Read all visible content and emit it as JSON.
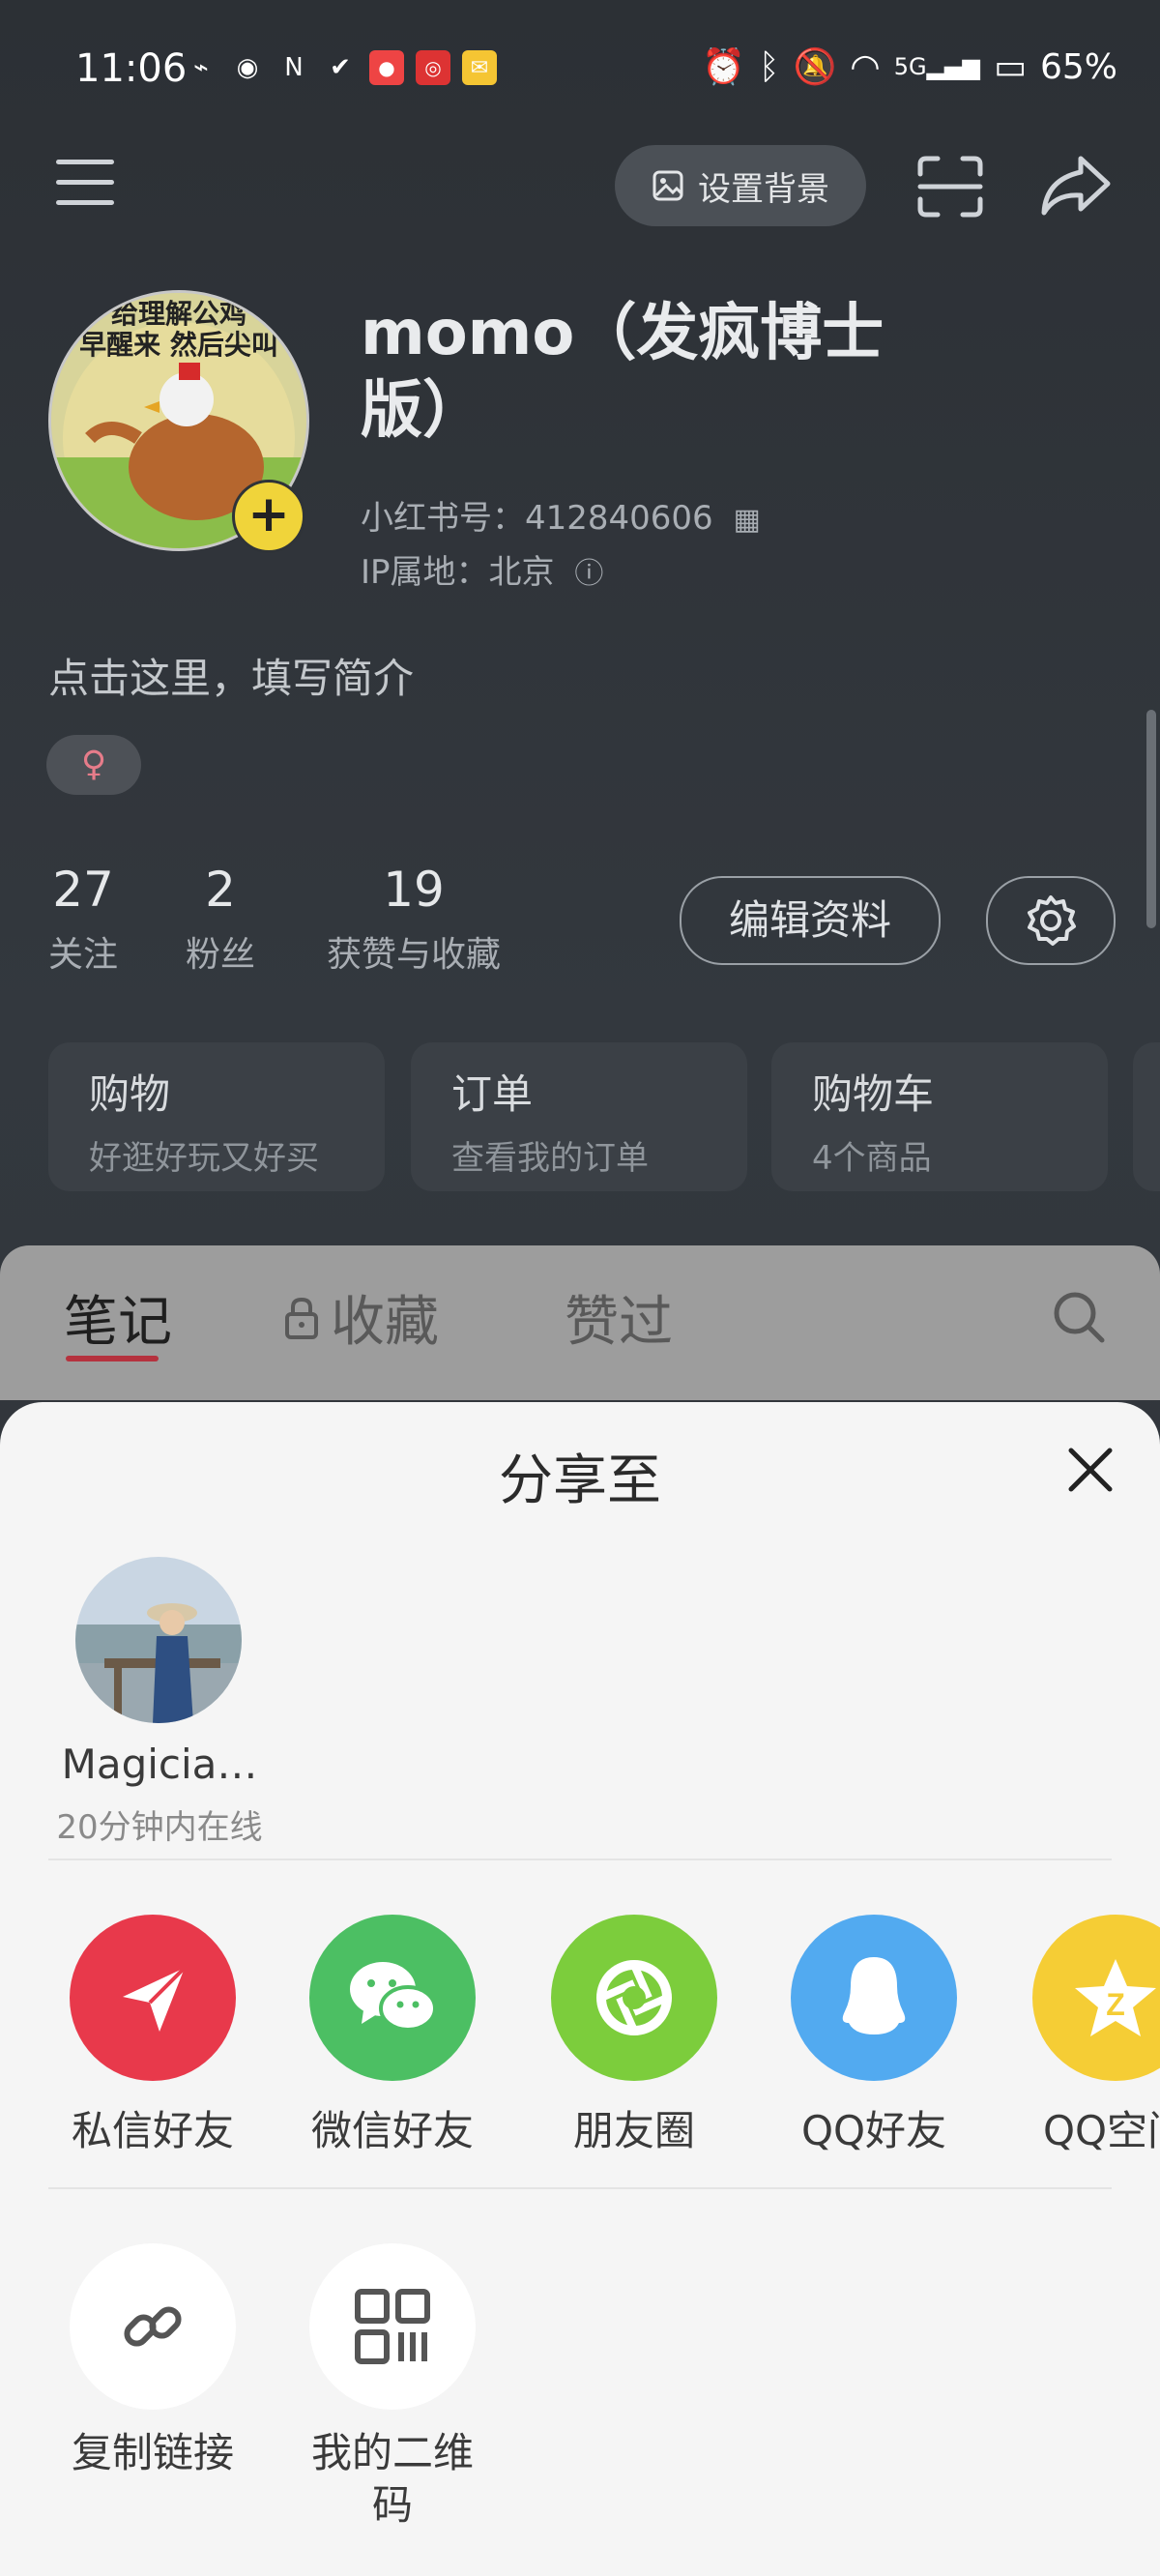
{
  "status_bar": {
    "time": "11:06",
    "battery": "65%",
    "network": "5G"
  },
  "toolbar": {
    "set_background_label": "设置背景"
  },
  "profile": {
    "nickname": "momo（发疯博士版）",
    "avatar_caption_1": "给理解公鸡",
    "avatar_caption_2": "早醒来 然后尖叫",
    "red_id": "小红书号：412840606",
    "ip": "IP属地：北京",
    "bio_placeholder": "点击这里，填写简介",
    "gender_symbol": "♀",
    "stats": [
      {
        "num": "27",
        "label": "关注"
      },
      {
        "num": "2",
        "label": "粉丝"
      },
      {
        "num": "19",
        "label": "获赞与收藏"
      }
    ],
    "edit_label": "编辑资料"
  },
  "cards": [
    {
      "title": "购物",
      "subtitle": "好逛好玩又好买"
    },
    {
      "title": "订单",
      "subtitle": "查看我的订单"
    },
    {
      "title": "购物车",
      "subtitle": "4个商品"
    }
  ],
  "tabs": {
    "notes": "笔记",
    "favorites": "收藏",
    "liked": "赞过"
  },
  "share_sheet": {
    "title": "分享至",
    "contact": {
      "name": "Magicia…",
      "status": "20分钟内在线"
    },
    "targets": [
      {
        "label": "私信好友",
        "color": "#e8394b"
      },
      {
        "label": "微信好友",
        "color": "#4cbf63"
      },
      {
        "label": "朋友圈",
        "color": "#7ccd3c"
      },
      {
        "label": "QQ好友",
        "color": "#52aaf0"
      },
      {
        "label": "QQ空间",
        "color": "#f5cd35"
      }
    ],
    "utilities": [
      {
        "label": "复制链接"
      },
      {
        "label": "我的二维码"
      }
    ]
  }
}
